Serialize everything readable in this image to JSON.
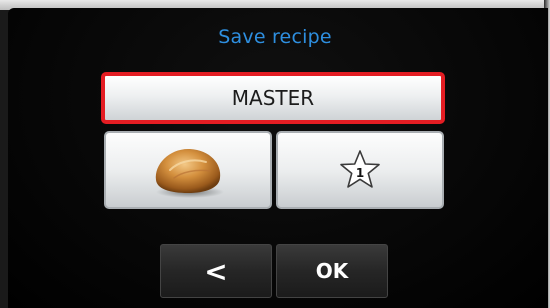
{
  "dialog": {
    "title": "Save recipe",
    "recipe_name": "MASTER"
  },
  "tiles": {
    "image_icon": "bread-roll-icon",
    "favourite_icon": "star-icon",
    "favourite_number": "1"
  },
  "nav": {
    "back_label": "<",
    "ok_label": "OK"
  },
  "colors": {
    "title": "#2e8fe0",
    "selection_border": "#e41d23",
    "screen_background": "#050505"
  }
}
